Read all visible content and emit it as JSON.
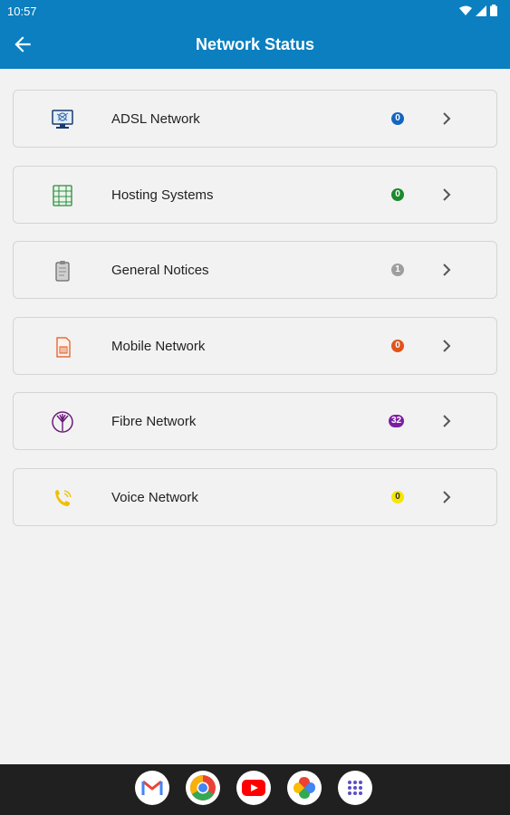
{
  "status_bar": {
    "time": "10:57"
  },
  "app_bar": {
    "title": "Network Status"
  },
  "items": [
    {
      "label": "ADSL Network",
      "count": "0",
      "color": "#1565c0",
      "icon": "monitor-network-icon"
    },
    {
      "label": "Hosting Systems",
      "count": "0",
      "color": "#1b8a2e",
      "icon": "server-rack-icon"
    },
    {
      "label": "General Notices",
      "count": "1",
      "color": "#9e9e9e",
      "icon": "clipboard-icon"
    },
    {
      "label": "Mobile Network",
      "count": "0",
      "color": "#e0541b",
      "icon": "sim-card-icon"
    },
    {
      "label": "Fibre Network",
      "count": "32",
      "color": "#7b1fa2",
      "icon": "fibre-tree-icon"
    },
    {
      "label": "Voice Network",
      "count": "0",
      "color": "#f5e600",
      "icon": "phone-ringing-icon"
    }
  ],
  "dock": [
    "gmail-icon",
    "chrome-icon",
    "youtube-icon",
    "photos-icon",
    "app-drawer-icon"
  ]
}
